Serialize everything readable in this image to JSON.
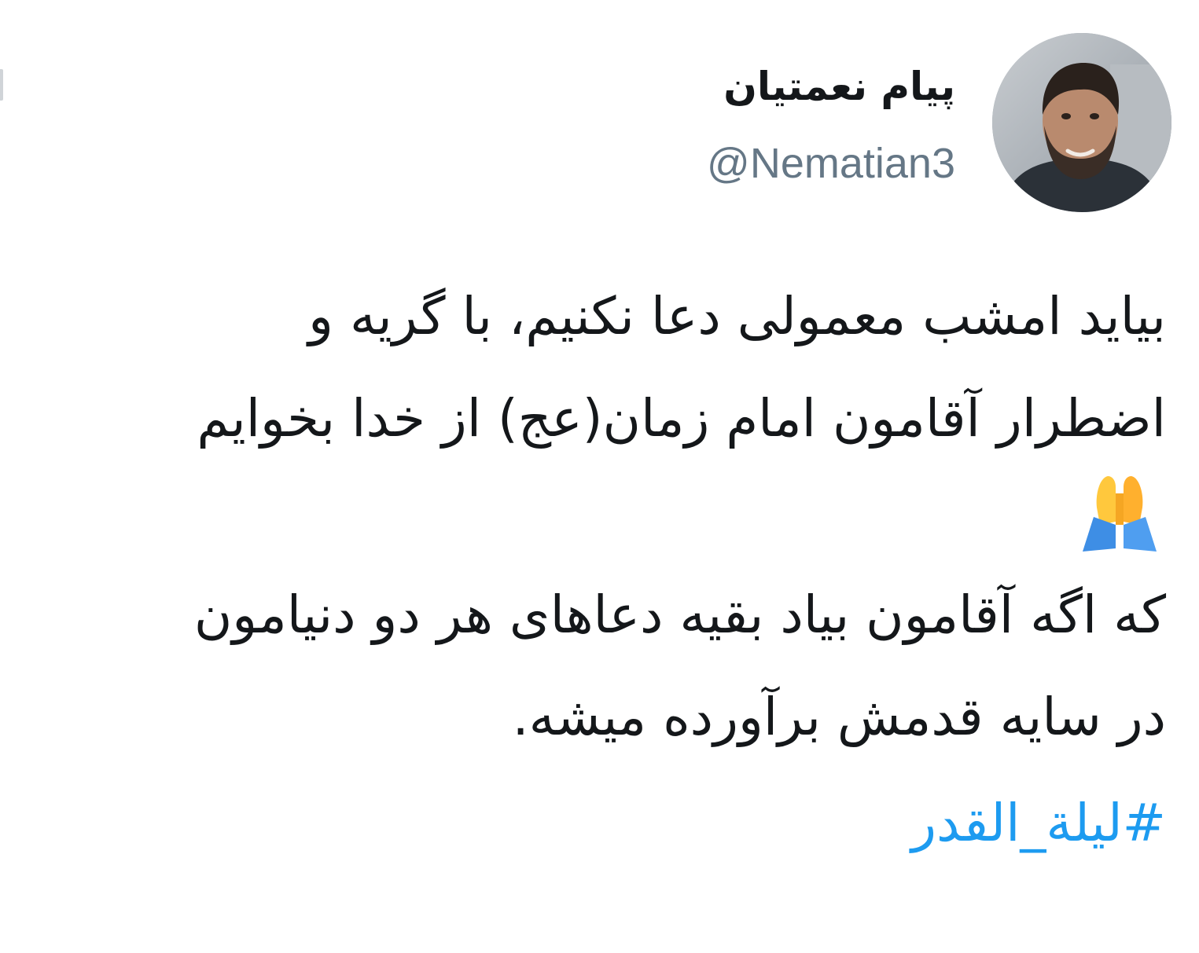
{
  "tweet": {
    "author": {
      "display_name": "پیام نعمتیان",
      "handle": "@Nematian3",
      "avatar_icon": "profile-photo"
    },
    "body": {
      "paragraph1": [
        "بیاید امشب معمولی دعا نکنیم، با گریه و",
        "اضطرار آقامون امام زمان(عج) از خدا بخوایم"
      ],
      "emoji": "folded-hands-icon",
      "paragraph2": [
        "که اگه آقامون بیاد بقیه دعاهای هر دو دنیامون",
        "در سایه قدمش برآورده میشه."
      ],
      "hashtag": "#لیلة_القدر"
    },
    "colors": {
      "text": "#14171a",
      "handle": "#657786",
      "hashtag": "#1d9bf0"
    }
  }
}
